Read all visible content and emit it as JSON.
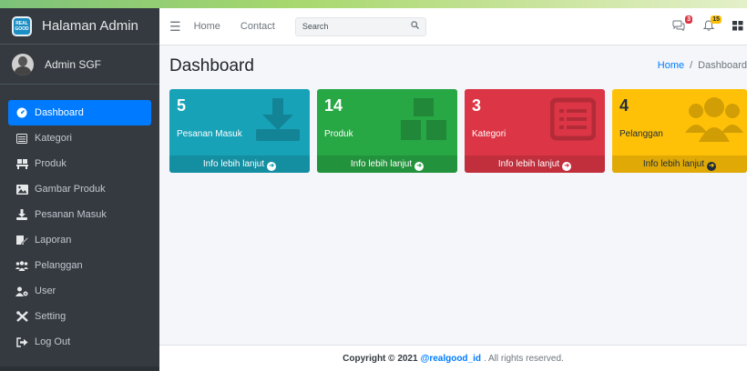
{
  "sidebar": {
    "brand": "Halaman Admin",
    "brand_logo_text": [
      "REAL",
      "GOOD"
    ],
    "user_name": "Admin SGF",
    "items": [
      {
        "label": "Dashboard",
        "icon": "dashboard-icon",
        "active": true
      },
      {
        "label": "Kategori",
        "icon": "list-icon"
      },
      {
        "label": "Produk",
        "icon": "pallet-icon"
      },
      {
        "label": "Gambar Produk",
        "icon": "image-icon"
      },
      {
        "label": "Pesanan Masuk",
        "icon": "download-icon"
      },
      {
        "label": "Laporan",
        "icon": "report-icon"
      },
      {
        "label": "Pelanggan",
        "icon": "users-icon"
      },
      {
        "label": "User",
        "icon": "user-cog-icon"
      },
      {
        "label": "Setting",
        "icon": "tools-icon"
      },
      {
        "label": "Log Out",
        "icon": "sign-out-icon"
      }
    ]
  },
  "navbar": {
    "home": "Home",
    "contact": "Contact",
    "search_placeholder": "Search",
    "messages_badge": "3",
    "notifications_badge": "15"
  },
  "content": {
    "title": "Dashboard",
    "breadcrumb": {
      "home": "Home",
      "separator": "/",
      "current": "Dashboard"
    }
  },
  "boxes": [
    {
      "value": "5",
      "label": "Pesanan Masuk",
      "footer": "Info lebih lanjut",
      "color": "#17a2b8",
      "icon": "download-icon"
    },
    {
      "value": "14",
      "label": "Produk",
      "footer": "Info lebih lanjut",
      "color": "#28a745",
      "icon": "pallet-icon"
    },
    {
      "value": "3",
      "label": "Kategori",
      "footer": "Info lebih lanjut",
      "color": "#dc3545",
      "icon": "list-alt-icon"
    },
    {
      "value": "4",
      "label": "Pelanggan",
      "footer": "Info lebih lanjut",
      "color": "#ffc107",
      "icon": "users-icon"
    }
  ],
  "footer": {
    "prefix": "Copyright © 2021",
    "link": "@realgood_id",
    "suffix": ". All rights reserved."
  }
}
